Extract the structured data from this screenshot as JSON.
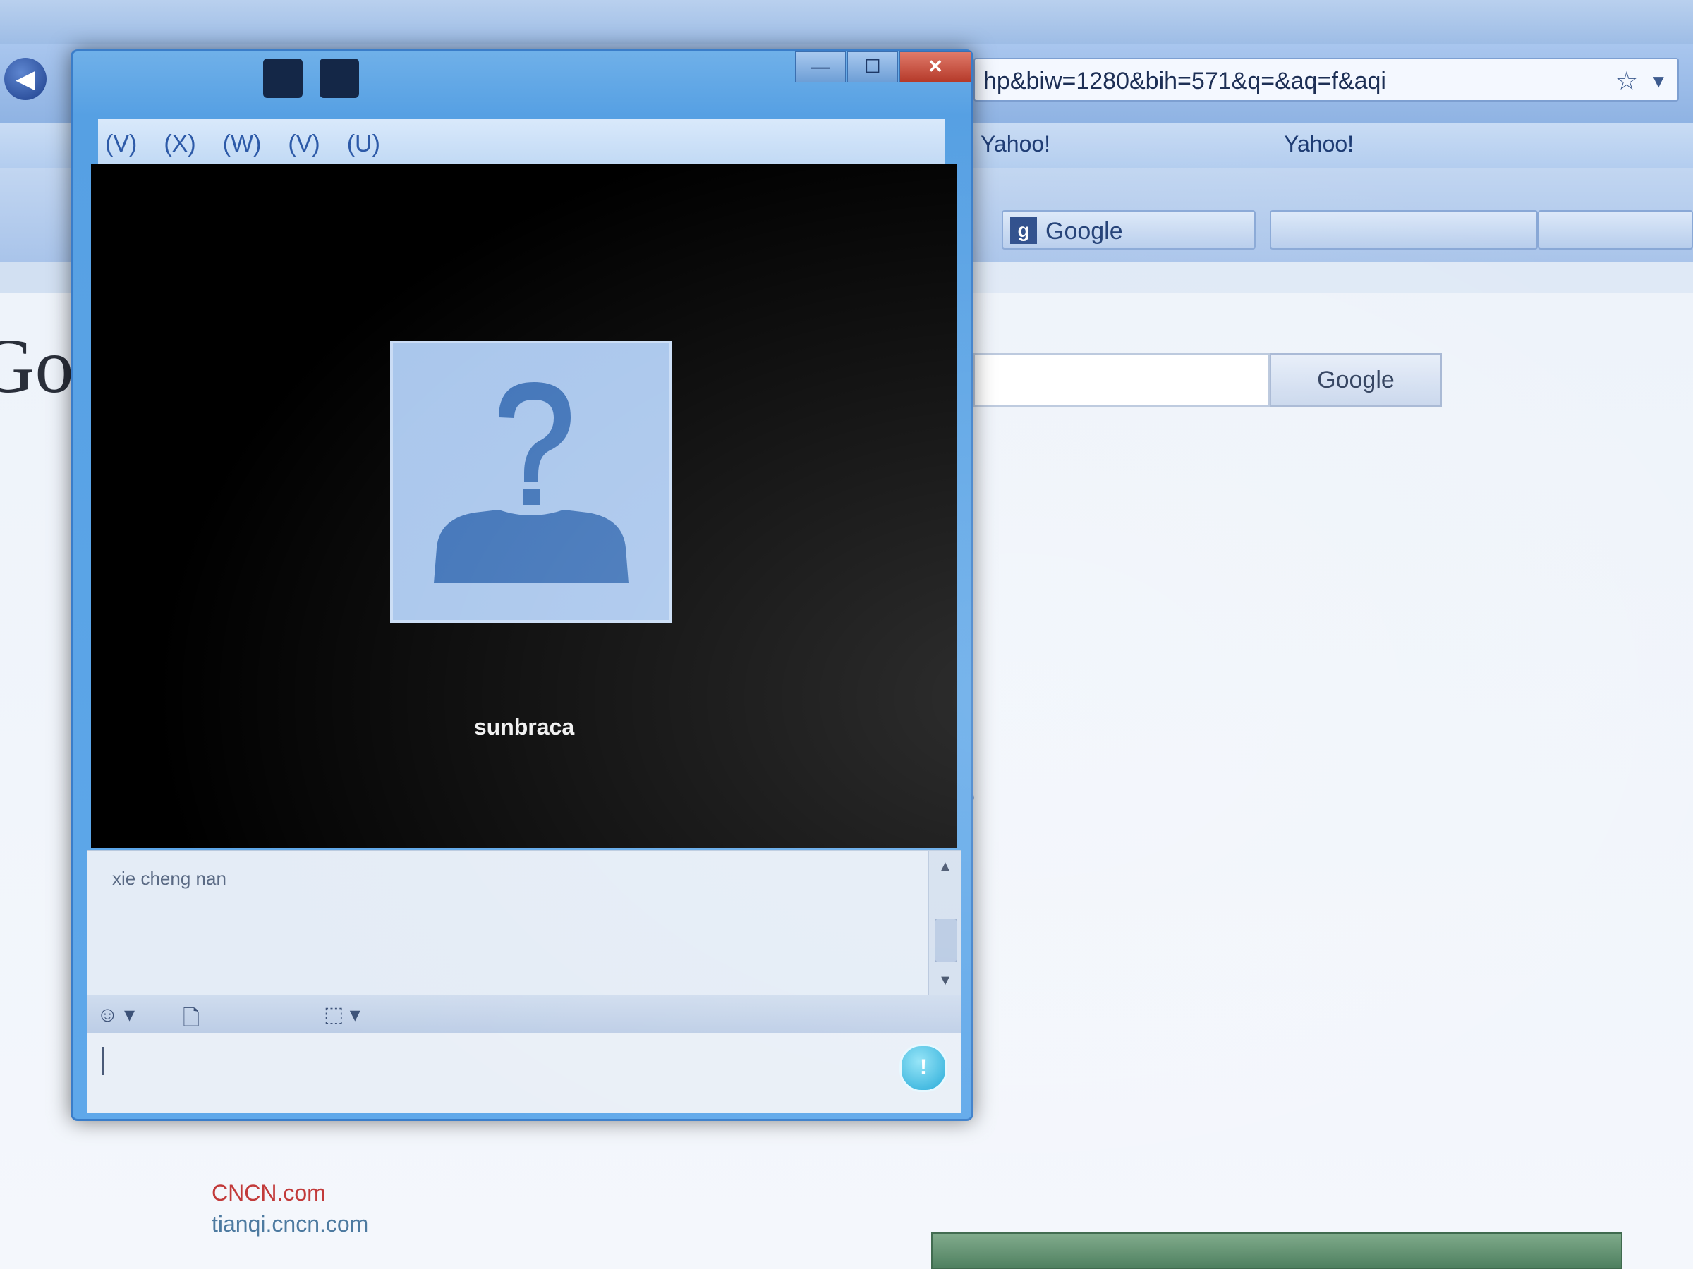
{
  "browser": {
    "menu": [
      "",
      "",
      "",
      "",
      "",
      ""
    ],
    "address": "hp&biw=1280&bih=571&q=",
    "address_suffix": "&aq=f&aqi",
    "bookmarks": [
      "Yahoo!",
      "Yahoo!"
    ],
    "toolbar": {
      "google": "Google"
    },
    "search_button": "Google",
    "adv_link": "",
    "left_tab": "",
    "results": [
      {
        "a": "",
        "hl": "",
        "b": ""
      },
      {
        "a": "",
        "hl": "",
        "b": ""
      },
      {
        "a": "",
        "hl": "",
        "b": ""
      },
      {
        "a": "",
        "hl": "",
        "b": ""
      },
      {
        "a": "",
        "hl": "",
        "b": ""
      },
      {
        "a": "",
        "hl": "",
        "b": ""
      },
      {
        "a": "",
        "hl": "",
        "b": ""
      }
    ],
    "bottom": {
      "line1": "",
      "line2": "CNCN.com",
      "line3": "tianqi.cncn.com"
    },
    "status_strip": ""
  },
  "chat": {
    "title": "",
    "menu": [
      "(V)",
      "(X)",
      "(W)",
      "(V)",
      "(U)"
    ],
    "contact_name": "sunbraca",
    "messages": [
      {
        "sender": "xie cheng nan",
        "text": "",
        "time": ""
      },
      {
        "text": "",
        "time": ""
      }
    ],
    "input_toolbar": {
      "emoticon": "",
      "send_file": "",
      "share": ""
    },
    "send_label": ""
  },
  "colors": {
    "accent": "#56a0e3",
    "video_bg": "#000000",
    "avatar_bg": "#a9c6ec",
    "highlight": "#c23a3a"
  }
}
